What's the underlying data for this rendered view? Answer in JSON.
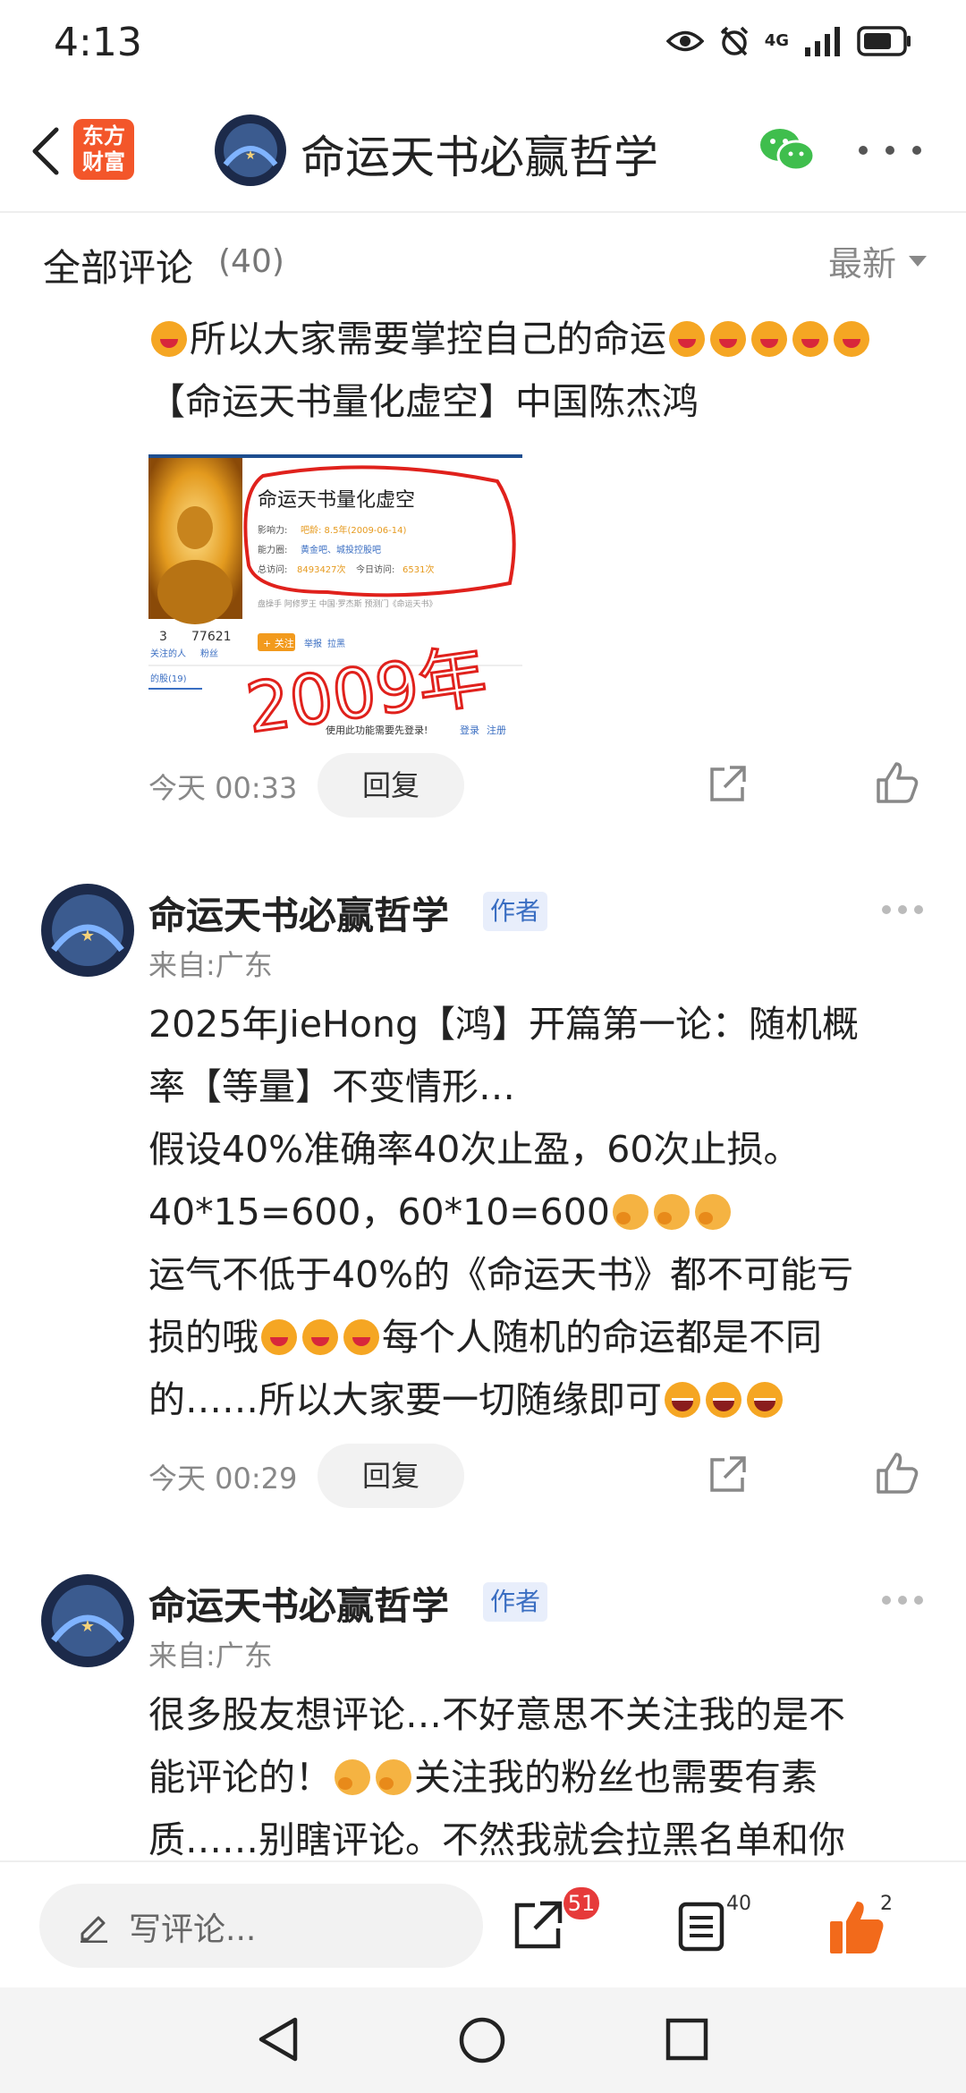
{
  "status_bar": {
    "time": "4:13",
    "network": "4G",
    "signal_strength": 4,
    "battery_level": 0.75
  },
  "header": {
    "logo_text": "东方财富",
    "title": "命运天书必赢哲学"
  },
  "comments_header": {
    "title": "全部评论",
    "count": "(40)",
    "sort": "最新"
  },
  "comment_1": {
    "line_1": "所以大家需要掌控自己的命运",
    "line_2": "【命运天书量化虚空】中国陈杰鸿",
    "image": {
      "name": "命运天书量化虚空",
      "influence_label": "影响力:",
      "influence_value": "吧龄: 8.5年(2009-06-14)",
      "ability_label": "能力圈:",
      "ability_value": "黄金吧、城投控股吧",
      "visits_label": "总访问:",
      "visits_value": "8493427次",
      "today_label": "今日访问:",
      "today_value": "6531次",
      "follow_count": "3",
      "follow_label": "关注的人",
      "fans_count": "77621",
      "fans_label": "粉丝",
      "follow_btn": "+ 关注",
      "report": "举报",
      "block": "拉黑",
      "tab": "的股(19)",
      "footer": "使用此功能需要先登录!",
      "login": "登录",
      "register": "注册",
      "bio": "盘操手 阿修罗王 中国·罗杰斯 预测门《命运天书》",
      "handwriting": "2009年"
    },
    "time": "今天 00:33",
    "reply_label": "回复"
  },
  "comment_2": {
    "author": "命运天书必赢哲学",
    "badge": "作者",
    "location": "来自:广东",
    "line_1": "2025年JieHong【鸿】开篇第一论：随机概",
    "line_2": "率【等量】不变情形…",
    "line_3": "假设40%准确率40次止盈，60次止损。",
    "line_4": "40*15=600，60*10=600",
    "line_5": "运气不低于40%的《命运天书》都不可能亏",
    "line_6a": "损的哦",
    "line_6b": "每个人随机的命运都是不同",
    "line_7": "的……所以大家要一切随缘即可",
    "time": "今天 00:29",
    "reply_label": "回复"
  },
  "comment_3": {
    "author": "命运天书必赢哲学",
    "badge": "作者",
    "location": "来自:广东",
    "line_1": "很多股友想评论…不好意思不关注我的是不",
    "line_2a": "能评论的！",
    "line_2b": "关注我的粉丝也需要有素",
    "line_3": "质……别瞎评论。不然我就会拉黑名单和你"
  },
  "bottom_bar": {
    "input_placeholder": "写评论...",
    "share_badge": "51",
    "comment_count": "40",
    "like_count": "2"
  },
  "colors": {
    "brand_orange": "#f3562a",
    "badge_red": "#e63a3a",
    "like_orange": "#f26a1b",
    "author_badge_bg": "#e8eefb",
    "author_badge_text": "#3a6ec2"
  }
}
